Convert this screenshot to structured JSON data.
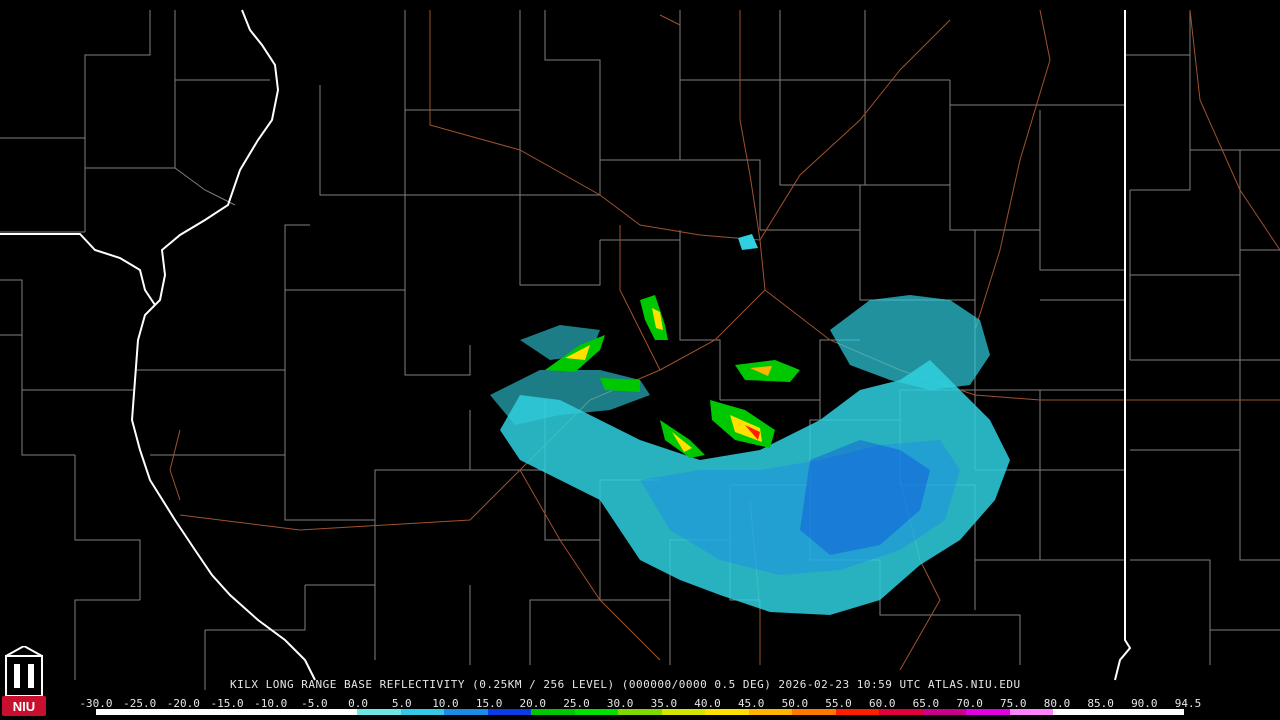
{
  "map": {
    "caption": "KILX LONG RANGE BASE REFLECTIVITY (0.25KM / 256 LEVEL) (000000/0000 0.5 DEG) 2026-02-23 10:59 UTC  ATLAS.NIU.EDU",
    "background_color": "#000000",
    "county_line_color": "#7f7f7f",
    "state_line_color": "#ffffff",
    "highway_color": "#a0522d"
  },
  "logo": {
    "text": "NIU",
    "color": "#c8102e"
  },
  "color_scale": {
    "labels": [
      "-30.0",
      "-25.0",
      "-20.0",
      "-15.0",
      "-10.0",
      "-5.0",
      "0.0",
      "5.0",
      "10.0",
      "15.0",
      "20.0",
      "25.0",
      "30.0",
      "35.0",
      "40.0",
      "45.0",
      "50.0",
      "55.0",
      "60.0",
      "65.0",
      "70.0",
      "75.0",
      "80.0",
      "85.0",
      "90.0",
      "94.5"
    ],
    "colors": [
      "#ffffff",
      "#ffffff",
      "#ffffff",
      "#ffffff",
      "#ffffff",
      "#ffffff",
      "#6fe6e6",
      "#33c8e6",
      "#1a8ce6",
      "#0a3ce6",
      "#00c800",
      "#00e100",
      "#7fd800",
      "#d2e600",
      "#ffe000",
      "#ffb400",
      "#ff7800",
      "#ff1e00",
      "#e1003c",
      "#c8008c",
      "#e100e1",
      "#ff82ff",
      "#ffffff",
      "#ffffff",
      "#ffffff"
    ]
  }
}
